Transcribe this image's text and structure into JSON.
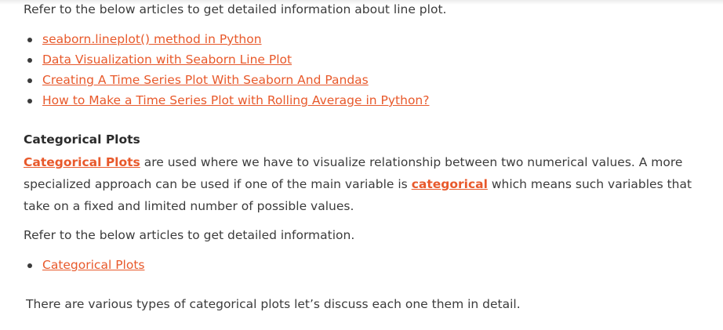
{
  "intro_text": "Refer to the below articles to get detailed information about line plot.",
  "line_plot_links": [
    "seaborn.lineplot() method in Python",
    "Data Visualization with Seaborn Line Plot",
    "Creating A Time Series Plot With Seaborn And Pandas",
    "How to Make a Time Series Plot with Rolling Average in Python?"
  ],
  "section_heading": "Categorical Plots",
  "paragraph": {
    "link1": "Categorical Plots",
    "text1": " are used where we have to visualize relationship between two numerical values. A more specialized approach can be used if one of the main variable is ",
    "link2": "categorical",
    "text2": " which means such variables that take on a fixed and limited number of possible values."
  },
  "refer_text": "Refer to the below articles to get detailed information.",
  "categorical_links": [
    "Categorical Plots"
  ],
  "closing_text": "There are various types of categorical plots let’s discuss each one them in detail.",
  "colors": {
    "link": "#e8592b",
    "text": "#3b3b3b"
  }
}
